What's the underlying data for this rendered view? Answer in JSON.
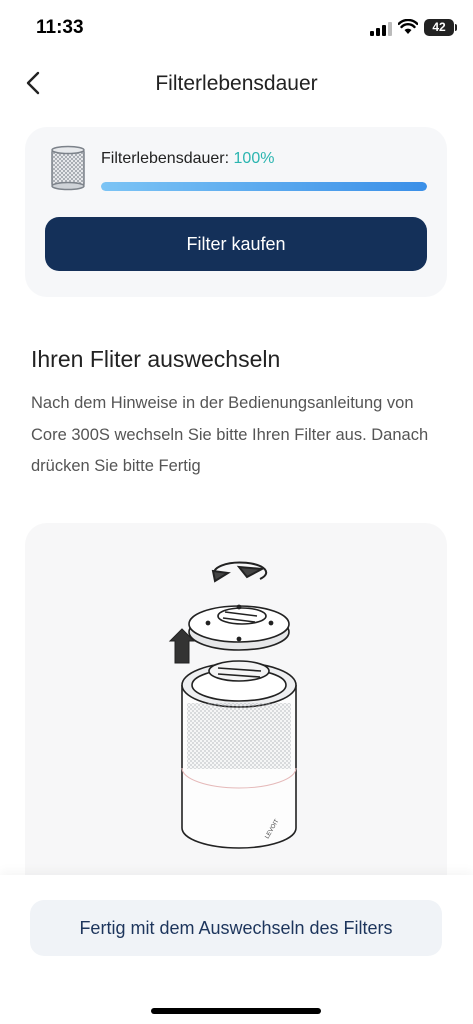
{
  "status_bar": {
    "time": "11:33",
    "battery": "42"
  },
  "nav": {
    "title": "Filterlebensdauer"
  },
  "filter_card": {
    "label": "Filterlebensdauer:",
    "percent_text": "100%",
    "life_fraction": 1.0,
    "buy_button": "Filter kaufen"
  },
  "instructions": {
    "heading": "Ihren Fliter auswechseln",
    "description": "Nach dem Hinweise in der Bedienungsanleitung von Core 300S wechseln Sie bitte Ihren Filter aus. Danach drücken Sie bitte Fertig"
  },
  "illustration": {
    "brand_text": "LEVOIT"
  },
  "footer": {
    "done_button": "Fertig mit dem Auswechseln des Filters"
  },
  "colors": {
    "primary": "#143059",
    "accent_teal": "#2bb5b0",
    "progress": "#3a8fe8"
  }
}
